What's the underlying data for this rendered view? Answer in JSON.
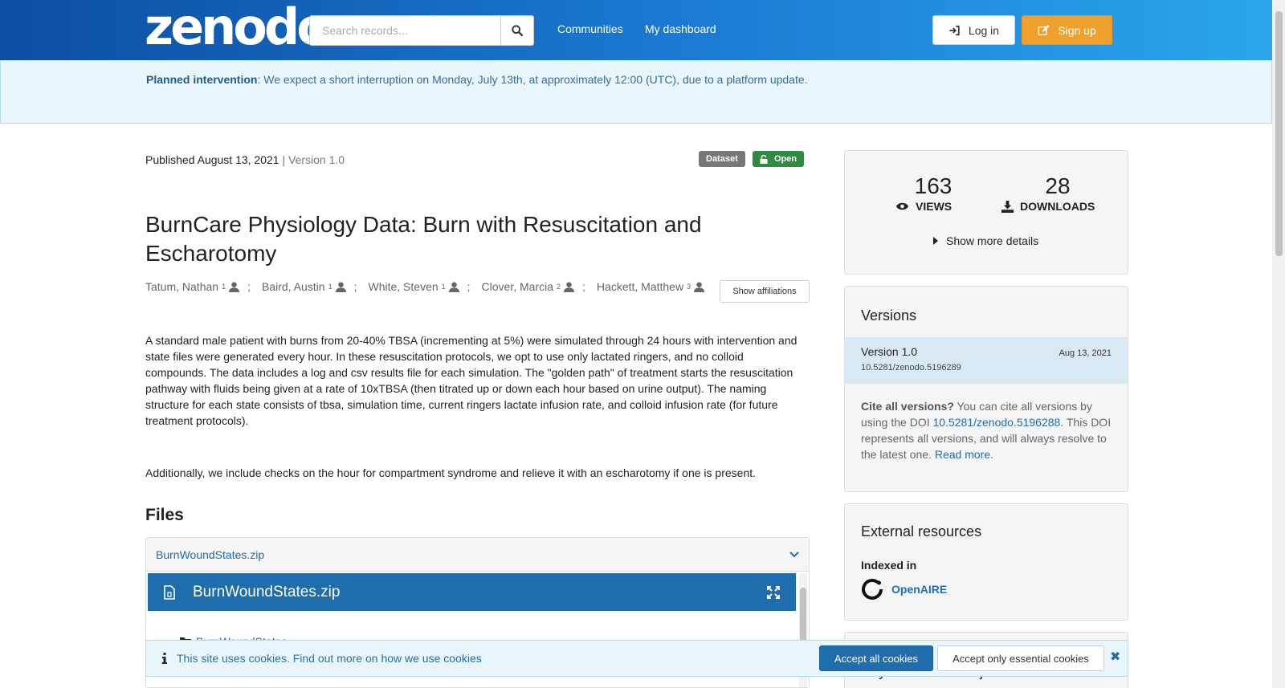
{
  "header": {
    "logo": "zenodo",
    "search_placeholder": "Search records...",
    "nav": [
      "Communities",
      "My dashboard"
    ],
    "login_label": "Log in",
    "signup_label": "Sign up"
  },
  "banner": {
    "title": "Planned intervention",
    "text": ": We expect a short interruption on Monday, July 13th, at approximately 12:00 (UTC), due to a platform update."
  },
  "record": {
    "published": "Published August 13, 2021",
    "version": "| Version 1.0",
    "badge_type": "Dataset",
    "badge_access": "Open",
    "title": "BurnCare Physiology Data: Burn with Resuscitation and Escharotomy",
    "authors": [
      {
        "name": "Tatum, Nathan",
        "aff": "1"
      },
      {
        "name": "Baird, Austin",
        "aff": "1"
      },
      {
        "name": "White, Steven",
        "aff": "1"
      },
      {
        "name": "Clover, Marcia",
        "aff": "2"
      },
      {
        "name": "Hackett, Matthew",
        "aff": "3"
      }
    ],
    "affiliations_button": "Show affiliations",
    "description": "A standard male patient with burns from 20-40% TBSA (incrementing at 5%) were simulated through 24 hours with intervention and state files were generated every hour. In these resuscitation protocols, we opt to use only lactated ringers, and no colloid compounds. The data includes a log and csv results file for each simulation. The \"golden path\" of treatment starts the resuscitation pathway with fluids being given at a rate of 10xTBSA (then titrated up or down each hour based on urine output). The naming structure for each state consists of tbsa, simulation time, current ringers lactate infusion rate, and colloid infusion rate (for future treatment protocols).",
    "description2": "Additionally, we include checks on the hour for compartment syndrome and relieve it with an escharotomy if one is present."
  },
  "files": {
    "heading": "Files",
    "file_name": "BurnWoundStates.zip",
    "preview_title": "BurnWoundStates.zip",
    "tree_item": "BurnWoundStates"
  },
  "stats": {
    "views": "163",
    "views_label": "VIEWS",
    "downloads": "28",
    "downloads_label": "DOWNLOADS",
    "more_details": "Show more details"
  },
  "versions": {
    "heading": "Versions",
    "current": "Version 1.0",
    "date": "Aug 13, 2021",
    "doi": "10.5281/zenodo.5196289",
    "cite_bold": "Cite all versions?",
    "cite_text1": " You can cite all versions by using the DOI ",
    "cite_doi": "10.5281/zenodo.5196288",
    "cite_text2": ". This DOI represents all versions, and will always resolve to the latest one. ",
    "read_more": "Read more",
    "period": "."
  },
  "external": {
    "heading": "External resources",
    "indexed_in": "Indexed in",
    "openaire": "OpenAIRE"
  },
  "keywords": {
    "heading": "Keywords and subjects"
  },
  "cookie": {
    "text": "This site uses cookies. Find out more on ",
    "link": "how we use cookies",
    "accept_all": "Accept all cookies",
    "accept_essential": "Accept only essential cookies"
  },
  "colors": {
    "header_start": "#0c4ea3",
    "header_end": "#2aa6ec",
    "signup": "#f0a12d",
    "link": "#1f6dad",
    "badge_dataset": "#777777",
    "badge_open": "#2e8b3f"
  }
}
